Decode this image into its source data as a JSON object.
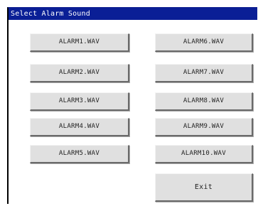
{
  "dialog": {
    "title": "Select Alarm Sound"
  },
  "buttons": {
    "left": [
      "ALARM1.WAV",
      "ALARM2.WAV",
      "ALARM3.WAV",
      "ALARM4.WAV",
      "ALARM5.WAV"
    ],
    "right": [
      "ALARM6.WAV",
      "ALARM7.WAV",
      "ALARM8.WAV",
      "ALARM9.WAV",
      "ALARM10.WAV"
    ],
    "exit": "Exit"
  },
  "colors": {
    "titlebar": "#0a1f96",
    "button_face": "#e0e0e0"
  }
}
